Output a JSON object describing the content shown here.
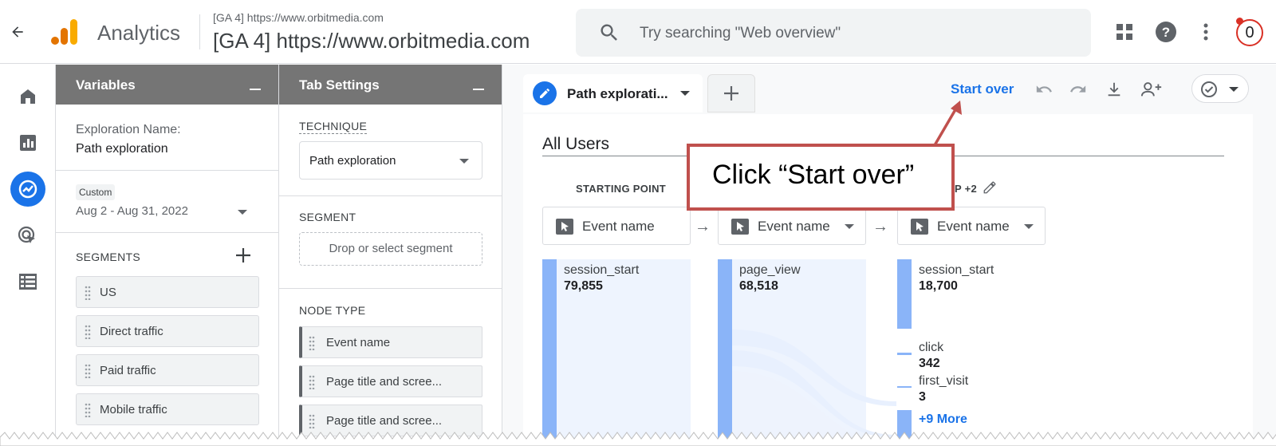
{
  "topbar": {
    "app_name": "Analytics",
    "property_small": "[GA 4] https://www.orbitmedia.com",
    "property_large": "[GA 4] https://www.orbitmedia.com",
    "search_placeholder": "Try searching \"Web overview\"",
    "notification_count": "0",
    "icons": [
      "back-arrow-icon",
      "analytics-logo",
      "search-icon",
      "apps-grid-icon",
      "help-icon",
      "more-vert-icon"
    ]
  },
  "rail": {
    "items": [
      "home-icon",
      "reports-icon",
      "explore-icon",
      "advertising-icon",
      "configure-icon"
    ],
    "active": "explore-icon"
  },
  "variables": {
    "title": "Variables",
    "exploration_name_label": "Exploration Name:",
    "exploration_name": "Path exploration",
    "date_tag": "Custom",
    "date_range": "Aug 2 - Aug 31, 2022",
    "segments_title": "SEGMENTS",
    "segments": [
      "US",
      "Direct traffic",
      "Paid traffic",
      "Mobile traffic"
    ]
  },
  "tab_settings": {
    "title": "Tab Settings",
    "technique_title": "TECHNIQUE",
    "technique_value": "Path exploration",
    "segment_title": "SEGMENT",
    "segment_placeholder": "Drop or select segment",
    "node_type_title": "NODE TYPE",
    "node_types": [
      "Event name",
      "Page title and scree...",
      "Page title and scree..."
    ]
  },
  "canvas": {
    "tab_name": "Path explorati...",
    "start_over": "Start over",
    "segment_label": "All Users",
    "columns": [
      {
        "title": "STARTING POINT",
        "node_type": "Event name"
      },
      {
        "title": "",
        "node_type": "Event name"
      },
      {
        "title": "EP +2",
        "node_type": "Event name"
      }
    ],
    "nodes": {
      "start": {
        "name": "session_start",
        "value": "79,855"
      },
      "step1": {
        "name": "page_view",
        "value": "68,518"
      },
      "step2": [
        {
          "name": "session_start",
          "value": "18,700"
        },
        {
          "name": "click",
          "value": "342"
        },
        {
          "name": "first_visit",
          "value": "3"
        }
      ],
      "more": "+9 More"
    }
  },
  "callout": {
    "text": "Click “Start over”",
    "color": "#c0504d"
  },
  "colors": {
    "accent": "#1a73e8",
    "node_bar": "#8ab4f8",
    "panel_header": "#757575"
  }
}
